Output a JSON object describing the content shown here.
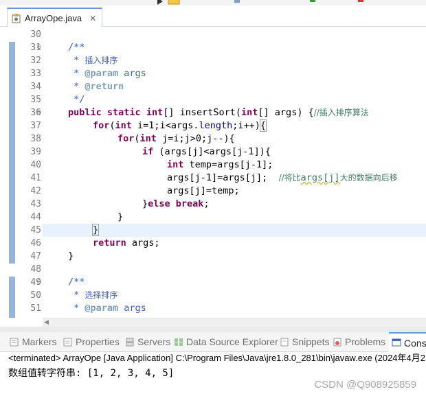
{
  "editor_tab": {
    "title": "ArrayOpe.java",
    "close_glyph": "✕"
  },
  "gutter": [
    "30",
    "31",
    "32",
    "33",
    "34",
    "35",
    "36",
    "37",
    "38",
    "39",
    "40",
    "41",
    "42",
    "43",
    "44",
    "45",
    "46",
    "47",
    "48",
    "49",
    "50",
    "51"
  ],
  "code": {
    "l32": {
      "star": " * ",
      "text": "插入排序"
    },
    "l33": {
      "star": " * ",
      "tag": "@param",
      "arg": " args"
    },
    "l34": {
      "star": " * ",
      "tag": "@return"
    },
    "l35": " */",
    "l31": "/**",
    "l36": {
      "kw1": "public",
      "kw2": "static",
      "kw3": "int",
      "t1": "[] insertSort(",
      "kw4": "int",
      "t2": "[] args) {",
      "comment": "//插入排序算法"
    },
    "l37": {
      "kw": "for",
      "p1": "(",
      "kw2": "int",
      "p2": " i=1;i<args.",
      "field": "length",
      "p3": ";i++)",
      "brace": "{"
    },
    "l38": {
      "kw": "for",
      "p1": "(",
      "kw2": "int",
      "p2": " j=i;j>0;j--){"
    },
    "l39": {
      "kw": "if",
      "p1": " (args[j]<args[j-1]){"
    },
    "l40": {
      "kw": "int",
      "p1": " temp=args[j-1];"
    },
    "l41": {
      "p1": "args[j-1]=args[j];  ",
      "c1": "//将比",
      "c2": "args[j]",
      "c3": "大的数据向后移"
    },
    "l42": {
      "p1": "args[j]=temp;"
    },
    "l43": {
      "p1": "}",
      "kw": "else",
      "kw2": "break",
      "p2": ";"
    },
    "l44": "}",
    "l45": "}",
    "l46": {
      "kw": "return",
      "p1": " args;"
    },
    "l47": "}",
    "l49": "/**",
    "l50": {
      "star": " * ",
      "text": "选择排序"
    },
    "l51": {
      "star": " * ",
      "tag": "@param",
      "arg": " args"
    }
  },
  "views": {
    "markers": "Markers",
    "properties": "Properties",
    "servers": "Servers",
    "data_source": "Data Source Explorer",
    "snippets": "Snippets",
    "problems": "Problems",
    "console": "Conso"
  },
  "console": {
    "terminated": "<terminated> ArrayOpe [Java Application] C:\\Program Files\\Java\\jre1.8.0_281\\bin\\javaw.exe (2024年4月2",
    "output": "数组值转字符串: [1, 2, 3, 4, 5]"
  },
  "watermark": "CSDN @Q908925859",
  "colors": {
    "keyword": "#7f0055",
    "javadoc": "#3f5fbf",
    "comment": "#3f7f5f",
    "field": "#0000c0",
    "accent": "#6d96d6"
  }
}
